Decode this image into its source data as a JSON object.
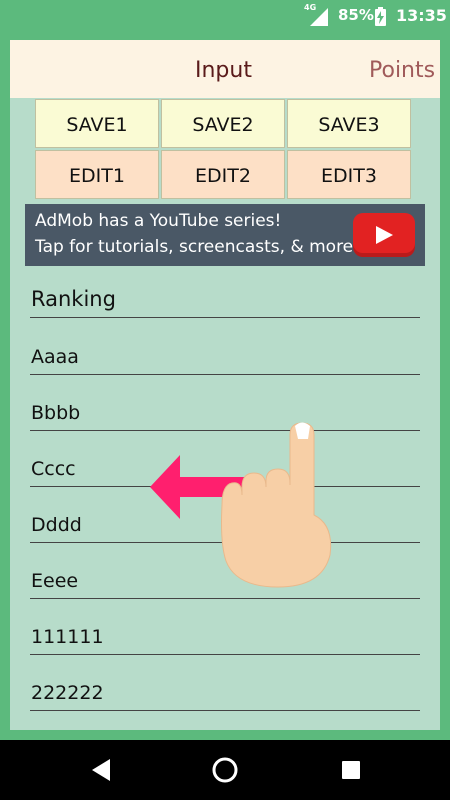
{
  "status_bar": {
    "network": "4G",
    "battery_percent": "85%",
    "time": "13:35",
    "icons": [
      "signal-icon",
      "battery-charging-icon"
    ]
  },
  "tabs": [
    {
      "label": "Input"
    },
    {
      "label": "Points"
    }
  ],
  "buttons": {
    "save": [
      "SAVE1",
      "SAVE2",
      "SAVE3"
    ],
    "edit": [
      "EDIT1",
      "EDIT2",
      "EDIT3"
    ]
  },
  "ad": {
    "line1": "AdMob has a YouTube series!",
    "line2": "Tap for tutorials, screencasts, & more.",
    "icon": "youtube-play-icon"
  },
  "fields": [
    "Ranking",
    "Aaaa",
    "Bbbb",
    "Cccc",
    "Dddd",
    "Eeee",
    "111111",
    "222222"
  ],
  "gesture": {
    "icon": "swipe-left-hand-icon"
  },
  "nav_bar": {
    "icons": [
      "back-icon",
      "home-icon",
      "recent-apps-icon"
    ]
  },
  "colors": {
    "background": "#5cba7d",
    "content": "#b7dcca",
    "tab_bar": "#fdf3e3",
    "save_button": "#fafbd4",
    "edit_button": "#fde0c6",
    "ad_banner": "#4a5866",
    "arrow": "#ff1f6e"
  }
}
